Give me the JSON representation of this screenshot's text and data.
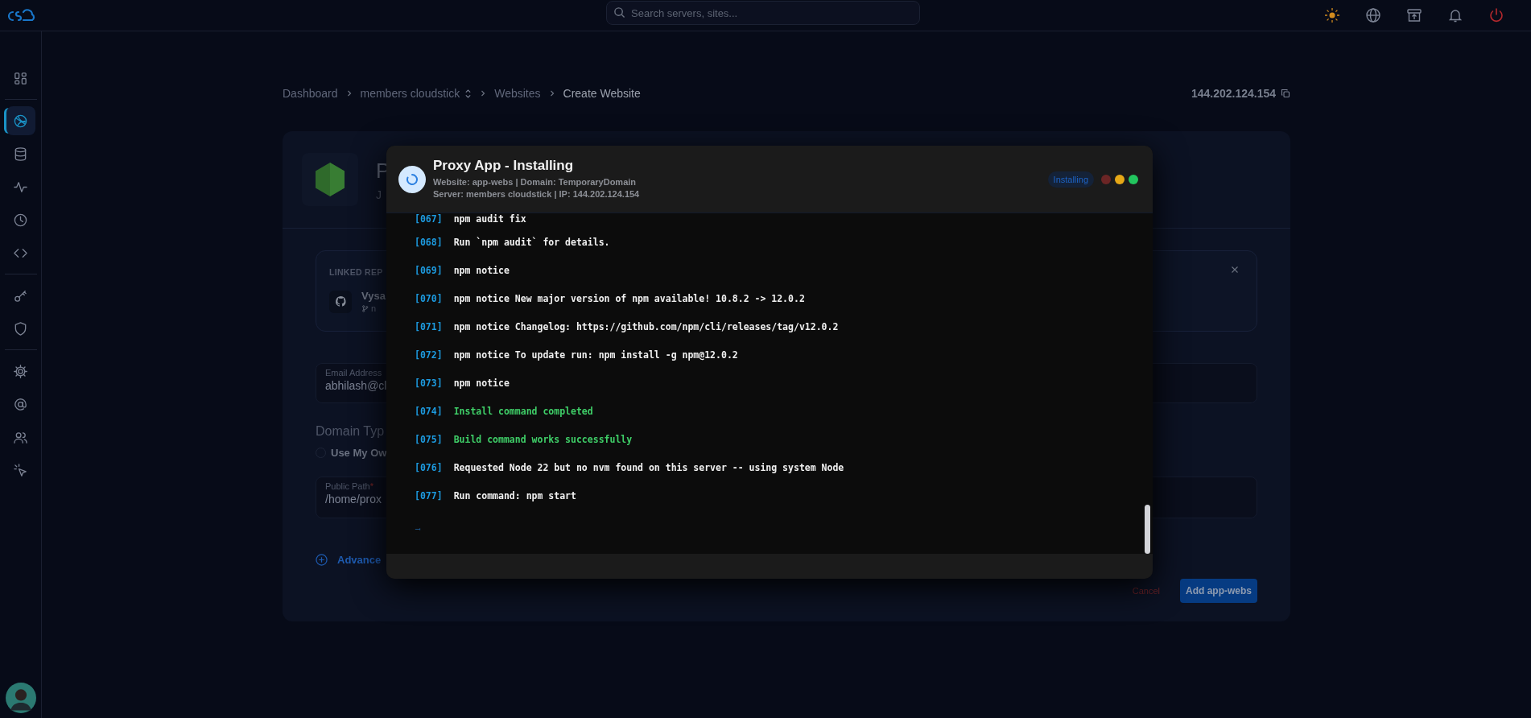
{
  "topbar": {
    "search": {
      "placeholder": "Search servers, sites..."
    }
  },
  "sidebar": {
    "groups": [
      [
        {
          "selected": false
        }
      ],
      [
        {
          "selected": true
        },
        {
          "selected": false
        },
        {
          "selected": false
        },
        {
          "selected": false
        },
        {
          "selected": false
        }
      ],
      [
        {
          "selected": false
        },
        {
          "selected": false
        }
      ],
      [
        {
          "selected": false
        },
        {
          "selected": false
        },
        {
          "selected": false
        },
        {
          "selected": false
        }
      ]
    ]
  },
  "breadcrumb": [
    {
      "label": "Dashboard",
      "switcher": false,
      "current": false
    },
    {
      "label": "members cloudstick",
      "switcher": true,
      "current": false
    },
    {
      "label": "Websites",
      "switcher": false,
      "current": false
    },
    {
      "label": "Create Website",
      "switcher": false,
      "current": true
    }
  ],
  "server_ip": "144.202.124.154",
  "form": {
    "title": "P",
    "subtitle": "J",
    "linked_repo": {
      "heading": "LINKED REP",
      "name": "Vysa",
      "branch": "n"
    },
    "email": {
      "label": "Email Address",
      "value": "abhilash@cl"
    },
    "domain_type": {
      "label": "Domain Typ",
      "option": "Use My Ow",
      "checked": false
    },
    "public_path": {
      "label": "Public Path",
      "required_mark": "*",
      "value": "/home/prox"
    },
    "advanced": "Advance",
    "buttons": {
      "cancel": "Cancel",
      "submit": "Add app-webs"
    }
  },
  "modal": {
    "title": "Proxy App - Installing",
    "info": [
      "Website: app-webs | Domain: TemporaryDomain",
      "Server: members cloudstick | IP: 144.202.124.154"
    ],
    "badge": "Installing",
    "dots": [
      {
        "color": "#6b2525"
      },
      {
        "color": "#e6a817"
      },
      {
        "color": "#22c55e"
      }
    ],
    "log": [
      {
        "num": "[067]",
        "text": "npm audit fix",
        "kind": "normal"
      },
      {
        "num": "[068]",
        "text": "Run `npm audit` for details.",
        "kind": "normal"
      },
      {
        "num": "[069]",
        "text": "npm notice",
        "kind": "normal"
      },
      {
        "num": "[070]",
        "text": "npm notice New major version of npm available! 10.8.2 -> 12.0.2",
        "kind": "normal"
      },
      {
        "num": "[071]",
        "text": "npm notice Changelog: https://github.com/npm/cli/releases/tag/v12.0.2",
        "kind": "normal"
      },
      {
        "num": "[072]",
        "text": "npm notice To update run: npm install -g npm@12.0.2",
        "kind": "normal"
      },
      {
        "num": "[073]",
        "text": "npm notice",
        "kind": "normal"
      },
      {
        "num": "[074]",
        "text": "Install command completed",
        "kind": "success"
      },
      {
        "num": "[075]",
        "text": "Build command works successfully",
        "kind": "success"
      },
      {
        "num": "[076]",
        "text": "Requested Node 22 but no nvm found on this server -- using system Node",
        "kind": "normal"
      },
      {
        "num": "[077]",
        "text": "Run command: npm start",
        "kind": "normal"
      }
    ]
  }
}
